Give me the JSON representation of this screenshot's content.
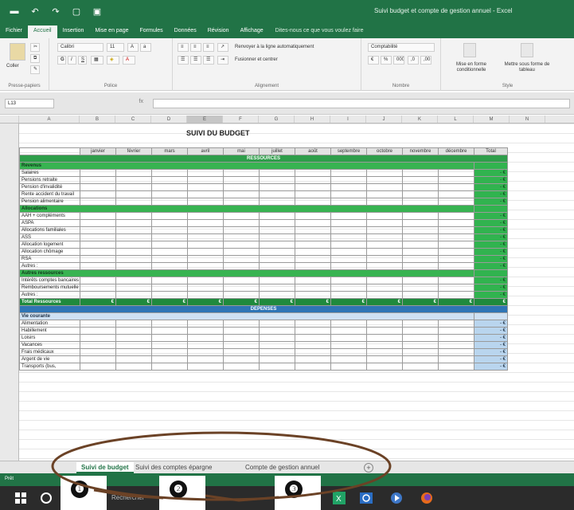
{
  "window": {
    "title": "Suivi budget et compte de gestion annuel - Excel"
  },
  "ribbon": {
    "tabs": [
      "Fichier",
      "Accueil",
      "Insertion",
      "Mise en page",
      "Formules",
      "Données",
      "Révision",
      "Affichage"
    ],
    "active_tab": "Accueil",
    "tell_me": "Dites-nous ce que vous voulez faire",
    "clipboard": {
      "paste": "Coller",
      "label": "Presse-papiers"
    },
    "font": {
      "name": "Calibri",
      "size": "11",
      "label": "Police"
    },
    "alignment": {
      "wrap": "Renvoyer à la ligne automatiquement",
      "merge": "Fusionner et centrer",
      "label": "Alignement"
    },
    "number": {
      "format": "Comptabilité",
      "label": "Nombre"
    },
    "styles": {
      "conditional": "Mise en forme conditionnelle",
      "table": "Mettre sous forme de tableau",
      "label": "Style"
    }
  },
  "formula_bar": {
    "name_box": "L13",
    "fx": "fx"
  },
  "sheet": {
    "title": "SUIVI DU BUDGET",
    "months": [
      "janvier",
      "février",
      "mars",
      "avril",
      "mai",
      "juillet",
      "août",
      "septembre",
      "octobre",
      "novembre",
      "décembre"
    ],
    "total_header": "Total",
    "resources_header": "RESSOURCES",
    "expenses_header": "DÉPENSES",
    "sections": [
      {
        "title": "Revenus",
        "rows": [
          "Salaires",
          "Pensions retraite",
          "Pension d'invalidité",
          "Rente accident du travail",
          "Pension alimentaire"
        ]
      },
      {
        "title": "Allocations",
        "rows": [
          "AAH + compléments",
          "ASPA",
          "Allocations familiales",
          "ASS",
          "Allocation logement",
          "Allocation chômage",
          "RSA",
          "Autres :"
        ]
      },
      {
        "title": "Autres ressources",
        "rows": [
          "Intérêts comptes bancaires",
          "Remboursements mutuelle ou CPAM",
          "Autres :"
        ]
      }
    ],
    "total_resources": "Total Ressources",
    "currency": "€",
    "dash": "-",
    "expense_section": {
      "title": "Vie courante",
      "rows": [
        "Alimentation",
        "Habillement",
        "Loisirs",
        "Vacances",
        "Frais médicaux",
        "Argent de vie",
        "Transports (bus,"
      ]
    }
  },
  "sheet_tabs": [
    "Suivi de budget",
    "Suivi des comptes épargne",
    "Compte de gestion annuel"
  ],
  "active_sheet": "Suivi de budget",
  "status_bar": {
    "text": "Prêt"
  },
  "taskbar": {
    "search": "Rechercher"
  },
  "callouts": [
    "❶",
    "❷",
    "❸"
  ],
  "colors": {
    "excel_green": "#217346",
    "resource_green": "#2e9e4a",
    "expense_blue": "#2f75b5",
    "annotation_ring": "#6b4226"
  }
}
